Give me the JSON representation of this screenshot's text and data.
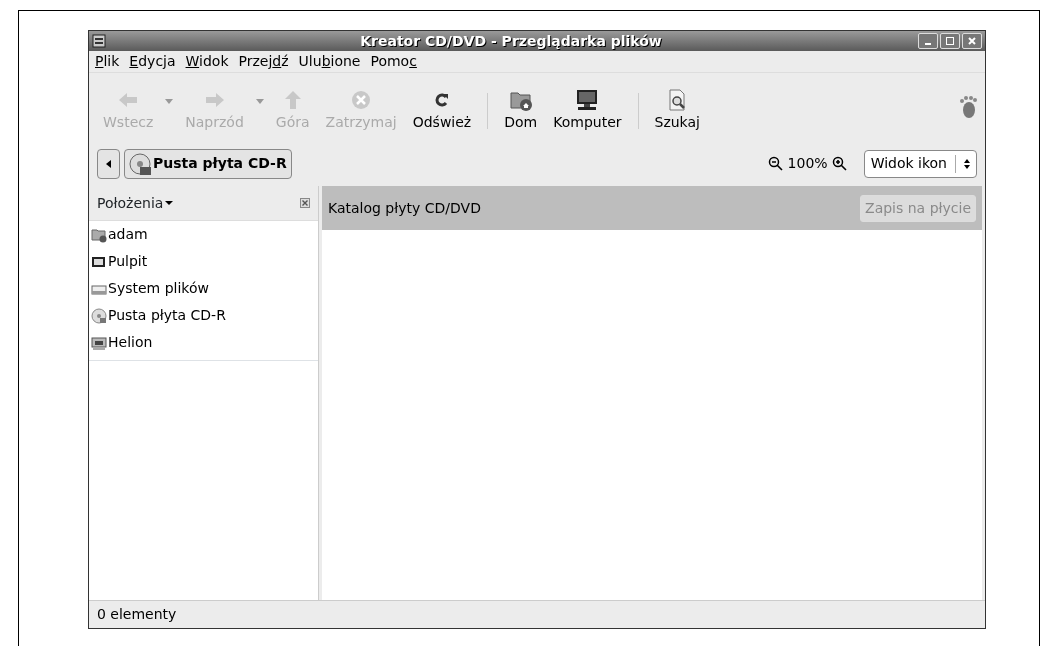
{
  "window": {
    "title": "Kreator CD/DVD - Przeglądarka plików"
  },
  "menu": [
    {
      "mnemonic": "P",
      "after": "lik"
    },
    {
      "mnemonic": "E",
      "after": "dycja"
    },
    {
      "mnemonic": "W",
      "after": "idok"
    },
    {
      "before": "Przej",
      "mnemonic": "d",
      "after": "ź"
    },
    {
      "before": "Ulu",
      "mnemonic": "b",
      "after": "ione"
    },
    {
      "before": "Pomo",
      "mnemonic": "c"
    }
  ],
  "toolbar": [
    {
      "kind": "back",
      "label": "Wstecz",
      "disabled": true,
      "dropdown": true
    },
    {
      "kind": "forward",
      "label": "Naprzód",
      "disabled": true,
      "dropdown": true
    },
    {
      "kind": "up",
      "label": "Góra",
      "disabled": true,
      "dropdown": false
    },
    {
      "kind": "stop",
      "label": "Zatrzymaj",
      "disabled": true,
      "dropdown": false
    },
    {
      "kind": "reload",
      "label": "Odśwież",
      "disabled": false,
      "dropdown": false
    },
    {
      "kind": "separator"
    },
    {
      "kind": "home",
      "label": "Dom",
      "disabled": false,
      "dropdown": false
    },
    {
      "kind": "computer",
      "label": "Komputer",
      "disabled": false,
      "dropdown": false
    },
    {
      "kind": "separator"
    },
    {
      "kind": "search",
      "label": "Szukaj",
      "disabled": false,
      "dropdown": false
    }
  ],
  "location": {
    "path_button": "Pusta płyta CD-R",
    "zoom": "100%",
    "view_select": "Widok ikon"
  },
  "sidebar": {
    "title": "Położenia",
    "items": [
      {
        "kind": "home",
        "label": "adam"
      },
      {
        "kind": "desktop",
        "label": "Pulpit"
      },
      {
        "kind": "drive",
        "label": "System plików"
      },
      {
        "kind": "cd",
        "label": "Pusta płyta CD-R"
      },
      {
        "kind": "ftp",
        "label": "Helion"
      }
    ]
  },
  "content": {
    "header": "Katalog płyty CD/DVD",
    "write_button": {
      "label": "Zapis na płycie",
      "disabled": true
    }
  },
  "status_bar": "0 elementy"
}
